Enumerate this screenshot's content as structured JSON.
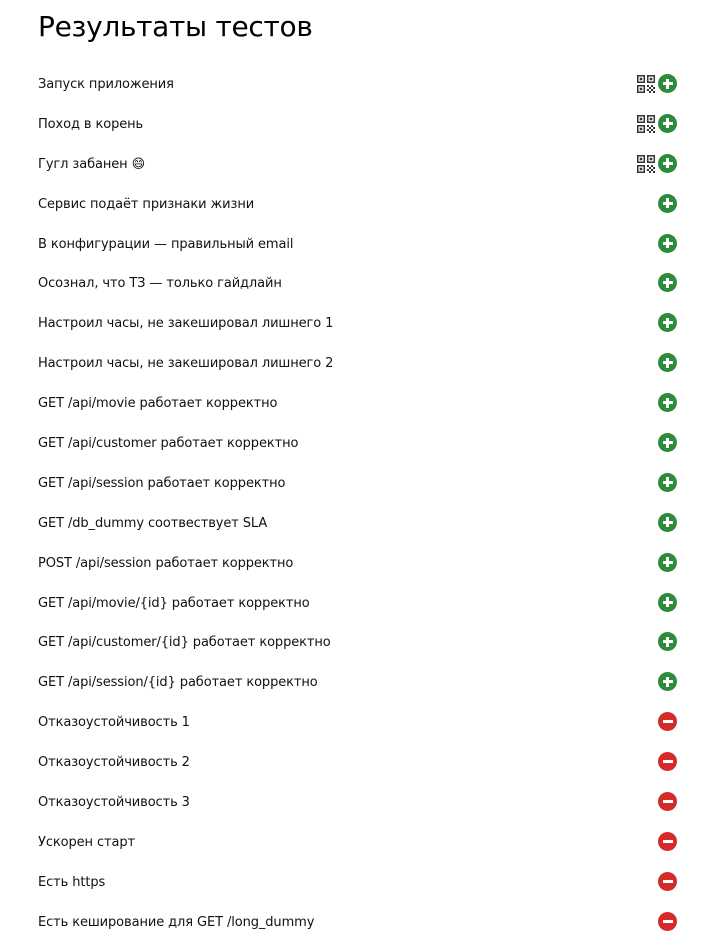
{
  "page": {
    "title": "Результаты тестов"
  },
  "colors": {
    "pass": "#2e8b3c",
    "fail": "#d52a2a"
  },
  "tests": [
    {
      "name": "Запуск приложения",
      "status": "pass",
      "qr": true
    },
    {
      "name": "Поход в корень",
      "status": "pass",
      "qr": true
    },
    {
      "name": "Гугл забанен 😄",
      "status": "pass",
      "qr": true
    },
    {
      "name": "Сервис подаёт признаки жизни",
      "status": "pass",
      "qr": false
    },
    {
      "name": "В конфигурации — правильный email",
      "status": "pass",
      "qr": false
    },
    {
      "name": "Осознал, что ТЗ — только гайдлайн",
      "status": "pass",
      "qr": false
    },
    {
      "name": "Настроил часы, не закешировал лишнего 1",
      "status": "pass",
      "qr": false
    },
    {
      "name": "Настроил часы, не закешировал лишнего 2",
      "status": "pass",
      "qr": false
    },
    {
      "name": "GET /api/movie работает корректно",
      "status": "pass",
      "qr": false
    },
    {
      "name": "GET /api/customer работает корректно",
      "status": "pass",
      "qr": false
    },
    {
      "name": "GET /api/session работает корректно",
      "status": "pass",
      "qr": false
    },
    {
      "name": "GET /db_dummy соотвествует SLA",
      "status": "pass",
      "qr": false
    },
    {
      "name": "POST /api/session работает корректно",
      "status": "pass",
      "qr": false
    },
    {
      "name": "GET /api/movie/{id} работает корректно",
      "status": "pass",
      "qr": false
    },
    {
      "name": "GET /api/customer/{id} работает корректно",
      "status": "pass",
      "qr": false
    },
    {
      "name": "GET /api/session/{id} работает корректно",
      "status": "pass",
      "qr": false
    },
    {
      "name": "Отказоустойчивость 1",
      "status": "fail",
      "qr": false
    },
    {
      "name": "Отказоустойчивость 2",
      "status": "fail",
      "qr": false
    },
    {
      "name": "Отказоустойчивость 3",
      "status": "fail",
      "qr": false
    },
    {
      "name": "Ускорен старт",
      "status": "fail",
      "qr": false
    },
    {
      "name": "Есть https",
      "status": "fail",
      "qr": false
    },
    {
      "name": "Есть кеширование для GET /long_dummy",
      "status": "fail",
      "qr": false
    }
  ]
}
